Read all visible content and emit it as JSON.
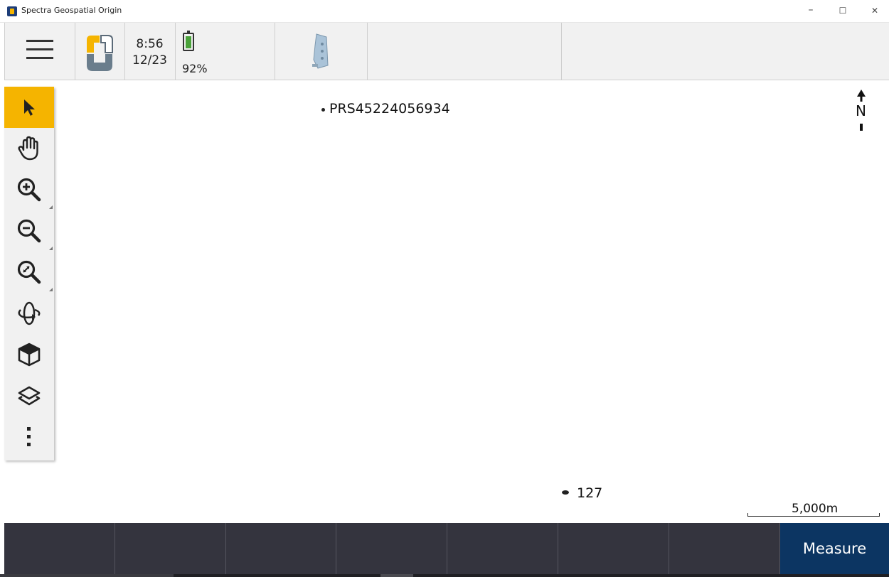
{
  "window": {
    "title": "Spectra Geospatial Origin",
    "controls": {
      "minimize": "–",
      "maximize": "☐",
      "close": "✕"
    }
  },
  "statusbar": {
    "time": "8:56",
    "date": "12/23",
    "battery_percent_label": "92%",
    "battery_level": 0.92,
    "battery_color": "#4aa23a"
  },
  "map": {
    "points": [
      {
        "label": "PRS45224056934"
      },
      {
        "label": "127"
      }
    ],
    "north_label": "N",
    "scale_label": "5,000m"
  },
  "tools": [
    {
      "name": "select-tool",
      "icon": "arrow-cursor-icon",
      "active": true
    },
    {
      "name": "pan-tool",
      "icon": "hand-icon"
    },
    {
      "name": "zoom-in-tool",
      "icon": "zoom-in-icon"
    },
    {
      "name": "zoom-out-tool",
      "icon": "zoom-out-icon"
    },
    {
      "name": "zoom-extents-tool",
      "icon": "zoom-extents-icon"
    },
    {
      "name": "orbit-tool",
      "icon": "orbit-icon"
    },
    {
      "name": "view-cube-tool",
      "icon": "cube-icon"
    },
    {
      "name": "layers-tool",
      "icon": "layers-icon"
    },
    {
      "name": "more-tool",
      "icon": "more-vertical-icon"
    }
  ],
  "softkeys": {
    "measure_label": "Measure"
  },
  "colors": {
    "accent": "#f5b400",
    "softkey_bg": "#34343e",
    "measure_bg": "#0c3562"
  }
}
